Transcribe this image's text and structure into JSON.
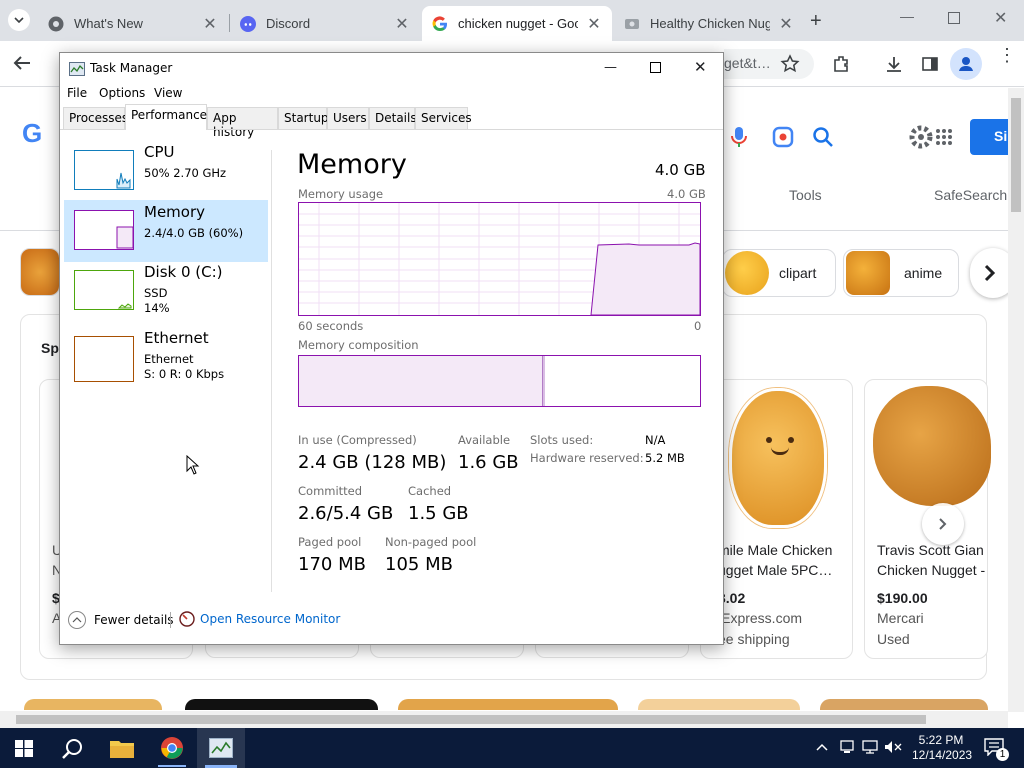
{
  "browser": {
    "tabs": [
      {
        "label": "What's New",
        "icon": "chrome-icon"
      },
      {
        "label": "Discord",
        "icon": "discord-icon"
      },
      {
        "label": "chicken nugget - Goo",
        "icon": "google-icon"
      },
      {
        "label": "Healthy Chicken Nugg",
        "icon": "image-icon"
      }
    ],
    "address_fragment": "get&t…"
  },
  "google_page": {
    "tabs_right": [
      "Tools",
      "SafeSearch"
    ],
    "chips": [
      "clipart",
      "anime"
    ],
    "sponsored_label": "Sp",
    "left_card_text": [
      "U",
      "N",
      "$",
      "A"
    ],
    "products": [
      {
        "title": "mile Male Chicken",
        "title2": "ugget Male 5PC…",
        "price": "3.02",
        "store": "iExpress.com",
        "extra": "ee shipping"
      },
      {
        "title": "Travis Scott Gian",
        "title2": "Chicken Nugget -",
        "price": "$190.00",
        "store": "Mercari",
        "extra": "Used"
      }
    ],
    "sign_in_partial": "Si"
  },
  "task_manager": {
    "title": "Task Manager",
    "menu": [
      "File",
      "Options",
      "View"
    ],
    "tabs": [
      "Processes",
      "Performance",
      "App history",
      "Startup",
      "Users",
      "Details",
      "Services"
    ],
    "sidebar": [
      {
        "title": "CPU",
        "line1": "50% 2.70 GHz",
        "line2": ""
      },
      {
        "title": "Memory",
        "line1": "2.4/4.0 GB (60%)",
        "line2": ""
      },
      {
        "title": "Disk 0 (C:)",
        "line1": "SSD",
        "line2": "14%"
      },
      {
        "title": "Ethernet",
        "line1": "Ethernet",
        "line2": "S: 0 R: 0 Kbps"
      }
    ],
    "detail": {
      "heading": "Memory",
      "total": "4.0 GB",
      "usage_label": "Memory usage",
      "usage_max": "4.0 GB",
      "time_left": "60 seconds",
      "time_right": "0",
      "composition_label": "Memory composition",
      "stats": {
        "in_use_label": "In use (Compressed)",
        "in_use_value": "2.4 GB (128 MB)",
        "available_label": "Available",
        "available_value": "1.6 GB",
        "slots_label": "Slots used:",
        "slots_value": "N/A",
        "hw_reserved_label": "Hardware reserved:",
        "hw_reserved_value": "5.2 MB",
        "committed_label": "Committed",
        "committed_value": "2.6/5.4 GB",
        "cached_label": "Cached",
        "cached_value": "1.5 GB",
        "paged_label": "Paged pool",
        "paged_value": "170 MB",
        "nonpaged_label": "Non-paged pool",
        "nonpaged_value": "105 MB"
      }
    },
    "footer": {
      "fewer_details": "Fewer details",
      "open_resource_monitor": "Open Resource Monitor"
    }
  },
  "taskbar": {
    "time": "5:22 PM",
    "date": "12/14/2023",
    "notification_count": "1"
  },
  "colors": {
    "memory_purple": "#8b12ae",
    "cpu_blue": "#117dbb",
    "disk_green": "#4da60c",
    "ethernet_orange": "#a74f01",
    "selected": "#cce8ff"
  }
}
